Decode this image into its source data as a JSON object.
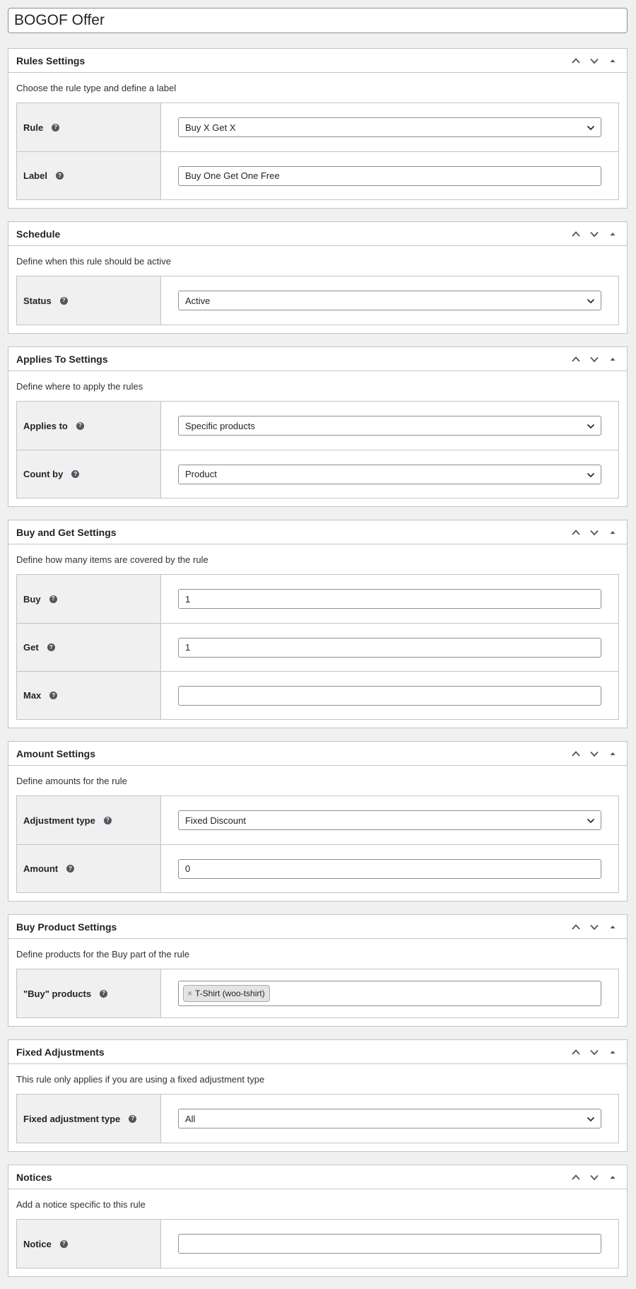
{
  "page": {
    "title": "BOGOF Offer"
  },
  "icons": {
    "move_up": "chevron-up-icon",
    "move_down": "chevron-down-icon",
    "toggle": "caret-up-icon",
    "help": "help-icon",
    "select": "chevron-down-icon"
  },
  "help_glyph": "?",
  "rules": {
    "title": "Rules Settings",
    "description": "Choose the rule type and define a label",
    "rule_label": "Rule",
    "rule_value": "Buy X Get X",
    "label_label": "Label",
    "label_value": "Buy One Get One Free"
  },
  "schedule": {
    "title": "Schedule",
    "description": "Define when this rule should be active",
    "status_label": "Status",
    "status_value": "Active"
  },
  "applies": {
    "title": "Applies To Settings",
    "description": "Define where to apply the rules",
    "applies_label": "Applies to",
    "applies_value": "Specific products",
    "count_label": "Count by",
    "count_value": "Product"
  },
  "buyget": {
    "title": "Buy and Get Settings",
    "description": "Define how many items are covered by the rule",
    "buy_label": "Buy",
    "buy_value": "1",
    "get_label": "Get",
    "get_value": "1",
    "max_label": "Max",
    "max_value": ""
  },
  "amount": {
    "title": "Amount Settings",
    "description": "Define amounts for the rule",
    "adjustment_label": "Adjustment type",
    "adjustment_value": "Fixed Discount",
    "amount_label": "Amount",
    "amount_value": "0"
  },
  "buyproduct": {
    "title": "Buy Product Settings",
    "description": "Define products for the Buy part of the rule",
    "products_label": "\"Buy\" products",
    "chip_remove": "×",
    "chips": [
      "T-Shirt (woo-tshirt)"
    ]
  },
  "fixed": {
    "title": "Fixed Adjustments",
    "description": "This rule only applies if you are using a fixed adjustment type",
    "type_label": "Fixed adjustment type",
    "type_value": "All"
  },
  "notices": {
    "title": "Notices",
    "description": "Add a notice specific to this rule",
    "notice_label": "Notice",
    "notice_value": ""
  }
}
